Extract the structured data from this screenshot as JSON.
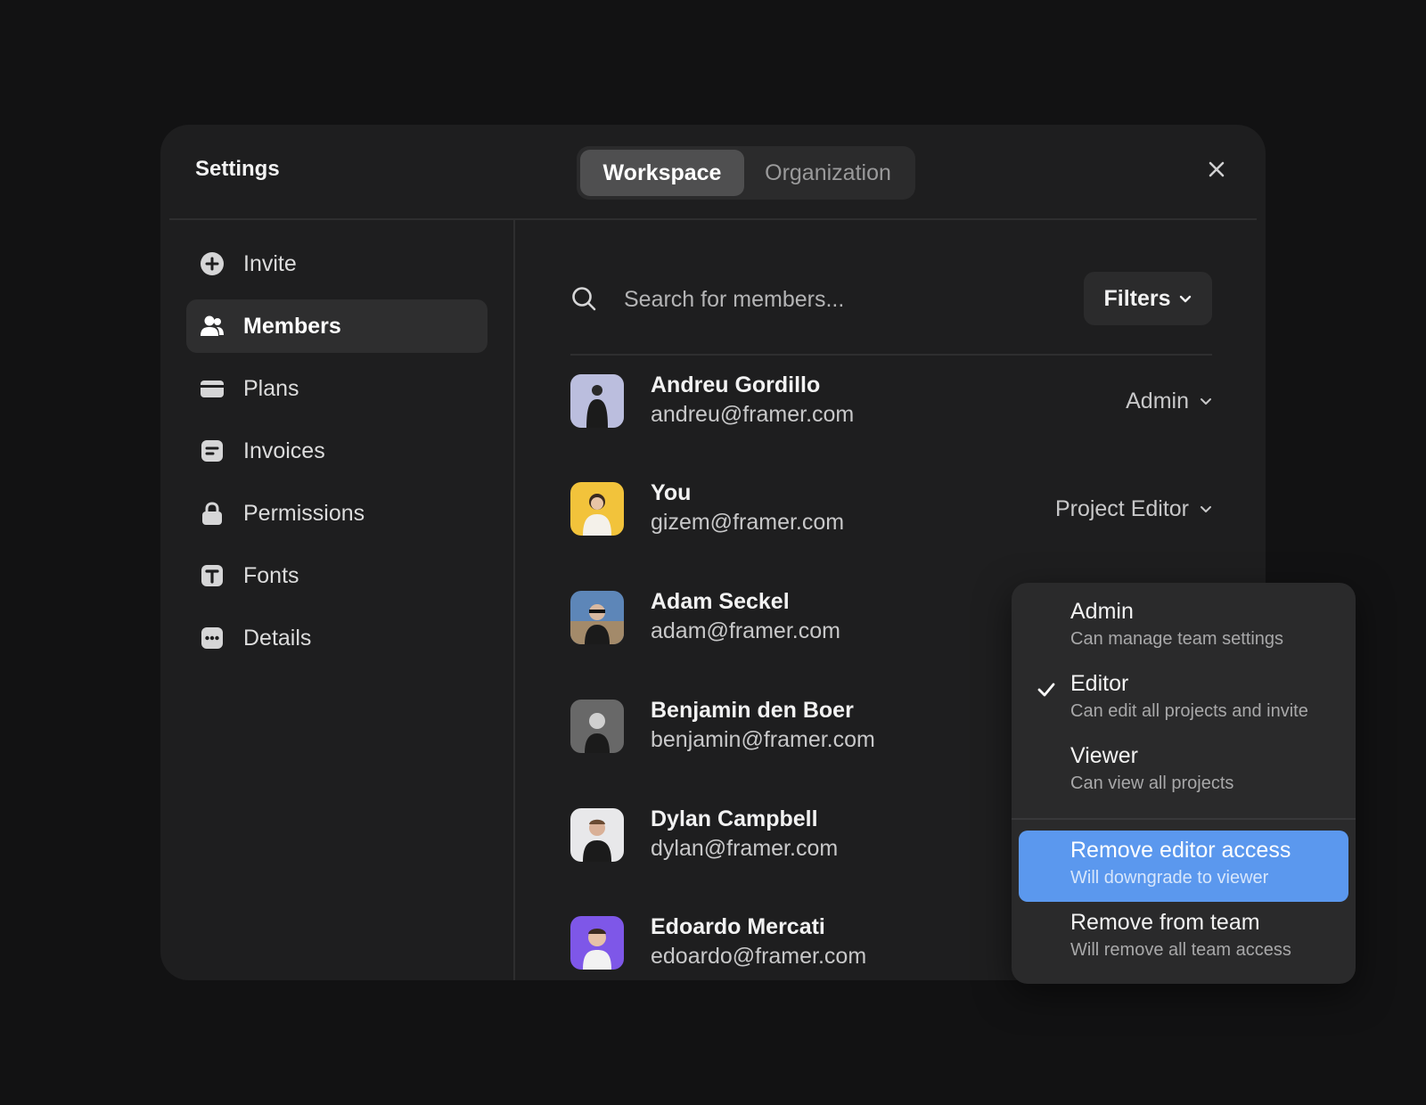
{
  "window": {
    "title": "Settings",
    "tabs": [
      {
        "label": "Workspace",
        "active": true
      },
      {
        "label": "Organization",
        "active": false
      }
    ],
    "close_icon": "close-icon"
  },
  "sidebar": {
    "items": [
      {
        "label": "Invite",
        "icon": "plus-circle-icon",
        "active": false
      },
      {
        "label": "Members",
        "icon": "users-icon",
        "active": true
      },
      {
        "label": "Plans",
        "icon": "credit-card-icon",
        "active": false
      },
      {
        "label": "Invoices",
        "icon": "document-icon",
        "active": false
      },
      {
        "label": "Permissions",
        "icon": "lock-icon",
        "active": false
      },
      {
        "label": "Fonts",
        "icon": "font-icon",
        "active": false
      },
      {
        "label": "Details",
        "icon": "more-icon",
        "active": false
      }
    ]
  },
  "search": {
    "placeholder": "Search for members...",
    "value": ""
  },
  "filters": {
    "label": "Filters"
  },
  "members": [
    {
      "name": "Andreu Gordillo",
      "email": "andreu@framer.com",
      "role": "Admin",
      "avatar_color": "#c9c9d6"
    },
    {
      "name": "You",
      "email": "gizem@framer.com",
      "role": "Project Editor",
      "avatar_color": "#f2c33b"
    },
    {
      "name": "Adam Seckel",
      "email": "adam@framer.com",
      "role": "",
      "avatar_color": "#5d86b8"
    },
    {
      "name": "Benjamin den Boer",
      "email": "benjamin@framer.com",
      "role": "",
      "avatar_color": "#5a5a5a"
    },
    {
      "name": "Dylan Campbell",
      "email": "dylan@framer.com",
      "role": "",
      "avatar_color": "#e8e8ea"
    },
    {
      "name": "Edoardo Mercati",
      "email": "edoardo@framer.com",
      "role": "",
      "avatar_color": "#7e57e8"
    }
  ],
  "role_menu": {
    "options": [
      {
        "title": "Admin",
        "subtitle": "Can manage team settings",
        "checked": false
      },
      {
        "title": "Editor",
        "subtitle": "Can edit all projects and invite",
        "checked": true
      },
      {
        "title": "Viewer",
        "subtitle": "Can view all projects",
        "checked": false
      }
    ],
    "actions": [
      {
        "title": "Remove editor access",
        "subtitle": "Will downgrade to viewer",
        "highlighted": true
      },
      {
        "title": "Remove from team",
        "subtitle": "Will remove all team access",
        "highlighted": false
      }
    ],
    "highlight_color": "#5b98ee"
  }
}
